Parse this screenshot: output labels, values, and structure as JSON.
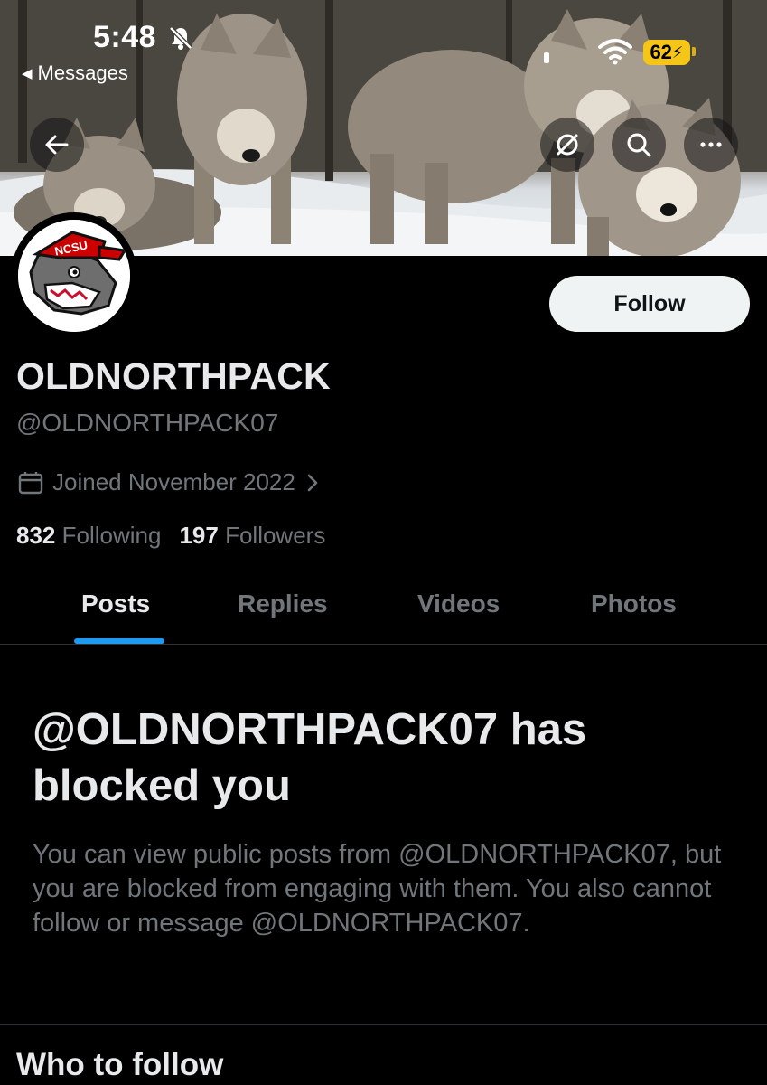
{
  "status_bar": {
    "time": "5:48",
    "back_app": "Messages",
    "battery": "62"
  },
  "profile": {
    "display_name": "OLDNORTHPACK",
    "handle": "@OLDNORTHPACK07",
    "joined": "Joined November 2022",
    "following_count": "832",
    "following_label": "Following",
    "followers_count": "197",
    "followers_label": "Followers",
    "follow_label": "Follow",
    "avatar_text": "NCSU"
  },
  "tabs": [
    {
      "label": "Posts",
      "active": true
    },
    {
      "label": "Replies",
      "active": false
    },
    {
      "label": "Videos",
      "active": false
    },
    {
      "label": "Photos",
      "active": false
    }
  ],
  "blocked": {
    "title": "@OLDNORTHPACK07 has blocked you",
    "body": "You can view public posts from @OLDNORTHPACK07, but you are blocked from engaging with them. You also cannot follow or message @OLDNORTHPACK07."
  },
  "section": {
    "who_to_follow": "Who to follow"
  },
  "colors": {
    "accent": "#1d9bf0",
    "muted_text": "#71767b",
    "primary_text": "#e7e9ea",
    "battery": "#f5c518"
  }
}
